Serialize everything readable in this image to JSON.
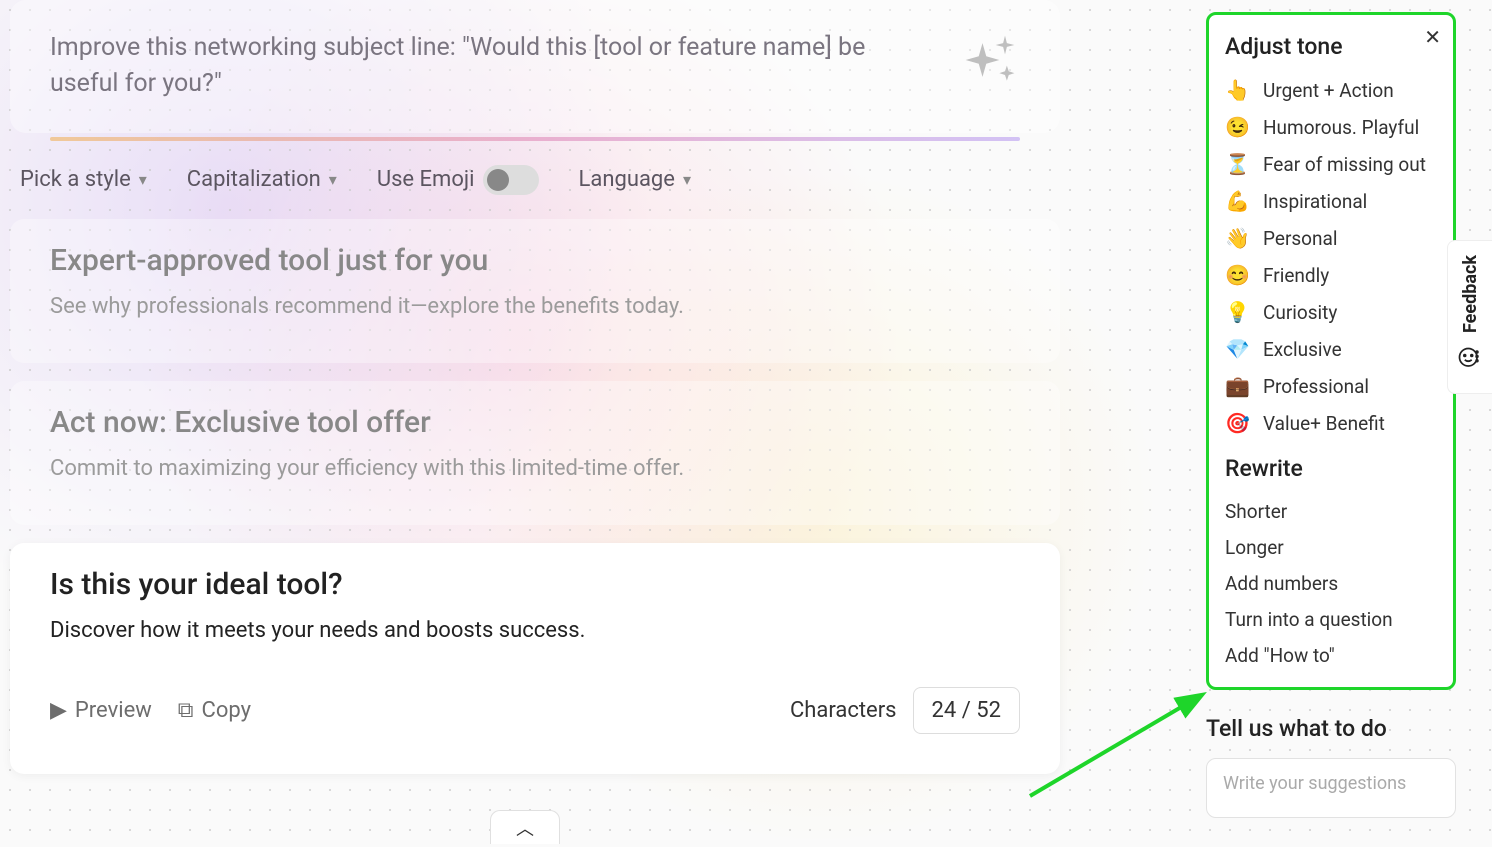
{
  "prompt": {
    "text": "Improve this networking subject line: \"Would this [tool or feature name] be useful for you?\""
  },
  "controls": {
    "style_label": "Pick a style",
    "capitalization_label": "Capitalization",
    "emoji_label": "Use Emoji",
    "language_label": "Language"
  },
  "results": [
    {
      "title": "Expert-approved tool just for you",
      "subtitle": "See why professionals recommend it—explore the benefits today."
    },
    {
      "title": "Act now: Exclusive tool offer",
      "subtitle": "Commit to maximizing your efficiency with this limited-time offer."
    },
    {
      "title": "Is this your ideal tool?",
      "subtitle": "Discover how it meets your needs and boosts success."
    }
  ],
  "actions": {
    "preview": "Preview",
    "copy": "Copy",
    "characters_label": "Characters",
    "characters_value": "24 / 52"
  },
  "side": {
    "adjust_tone_heading": "Adjust tone",
    "tones": [
      {
        "emoji": "👆",
        "label": "Urgent + Action"
      },
      {
        "emoji": "😉",
        "label": "Humorous. Playful"
      },
      {
        "emoji": "⏳",
        "label": "Fear of missing out"
      },
      {
        "emoji": "💪",
        "label": "Inspirational"
      },
      {
        "emoji": "👋",
        "label": "Personal"
      },
      {
        "emoji": "😊",
        "label": "Friendly"
      },
      {
        "emoji": "💡",
        "label": "Curiosity"
      },
      {
        "emoji": "💎",
        "label": "Exclusive"
      },
      {
        "emoji": "💼",
        "label": "Professional"
      },
      {
        "emoji": "🎯",
        "label": "Value+ Benefit"
      }
    ],
    "rewrite_heading": "Rewrite",
    "rewrites": [
      "Shorter",
      "Longer",
      "Add numbers",
      "Turn into a question",
      "Add \"How to\""
    ]
  },
  "tell_us": {
    "heading": "Tell us what to do",
    "placeholder": "Write your suggestions"
  },
  "feedback": {
    "label": "Feedback"
  }
}
